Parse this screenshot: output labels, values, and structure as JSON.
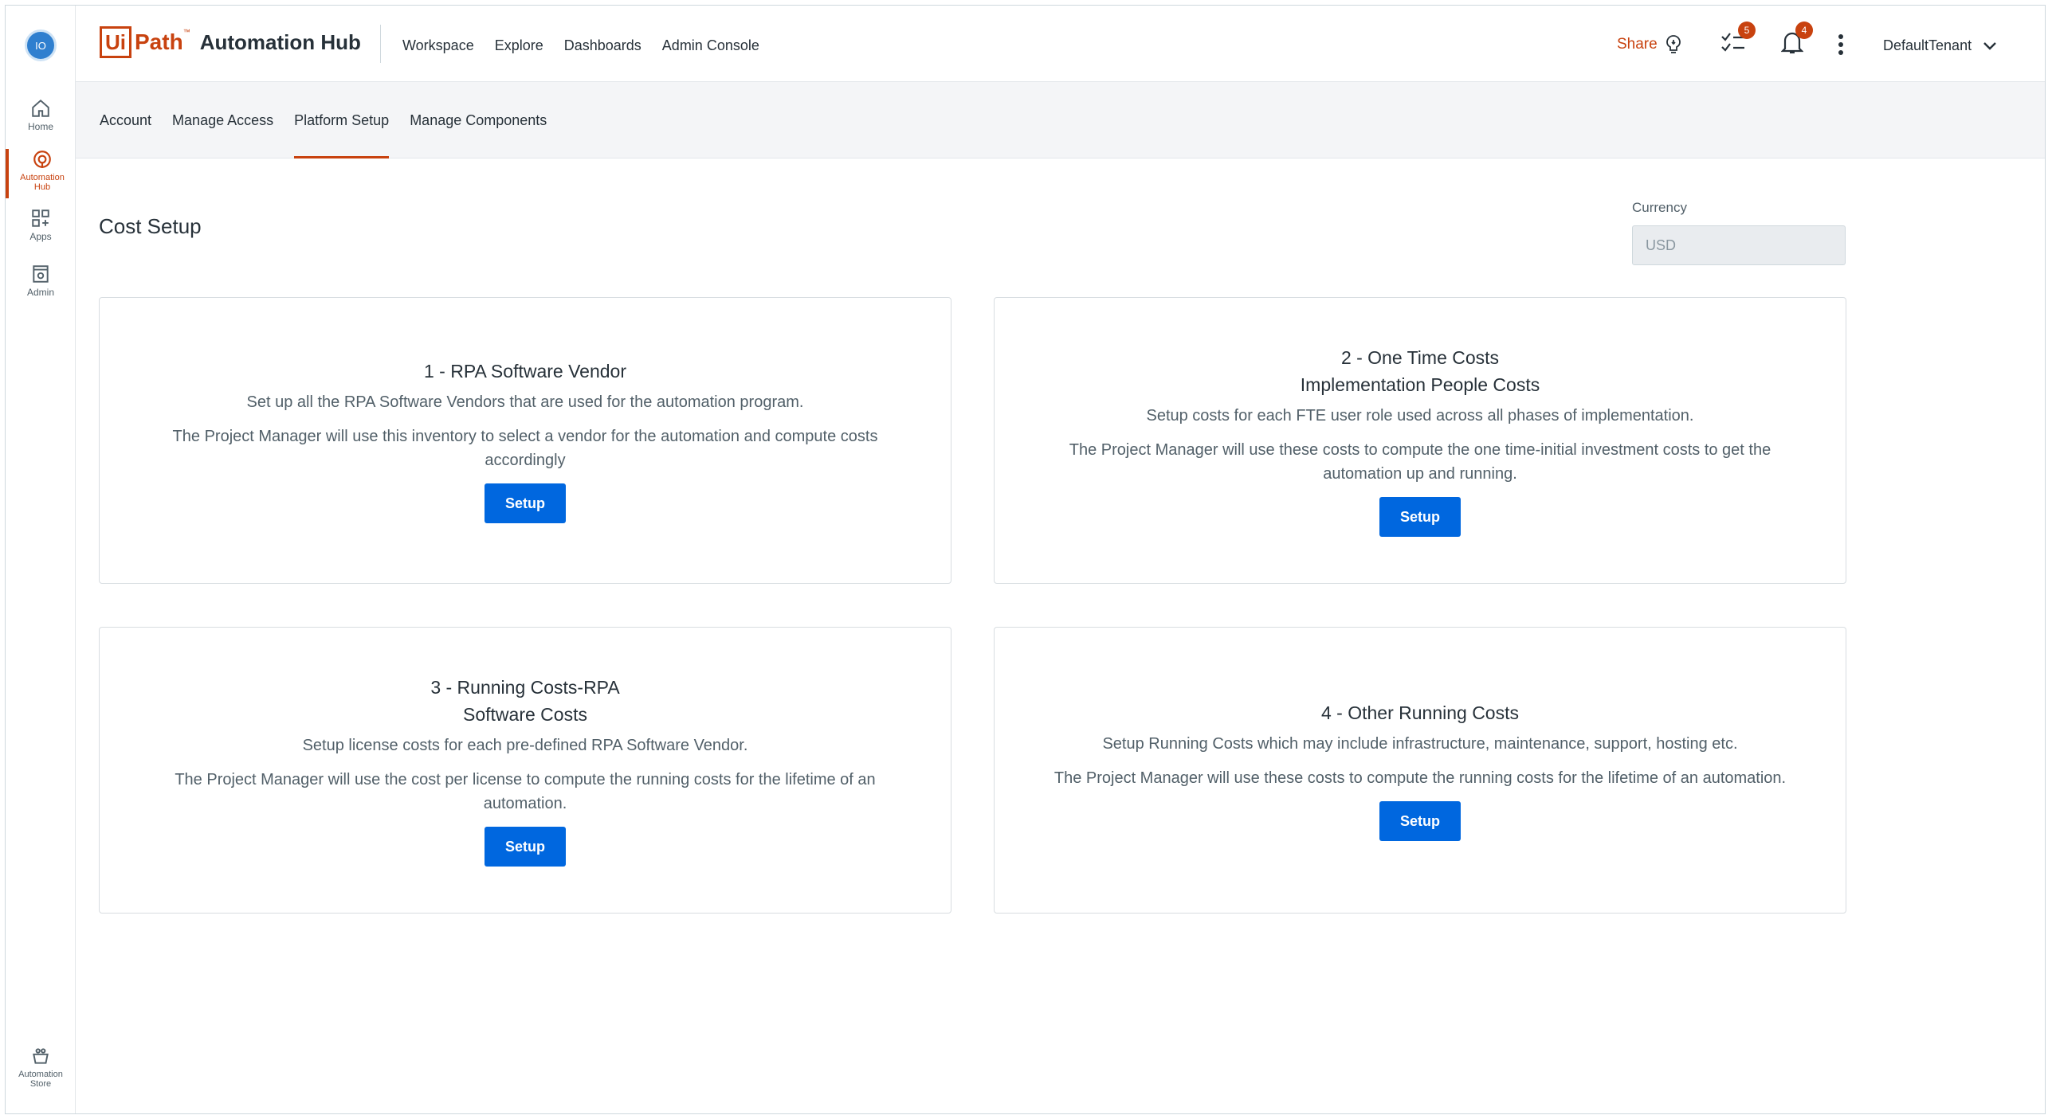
{
  "rail": {
    "avatar": "IO",
    "items": [
      {
        "label": "Home"
      },
      {
        "label": "Automation Hub"
      },
      {
        "label": "Apps"
      },
      {
        "label": "Admin"
      }
    ],
    "bottom": {
      "label": "Automation Store"
    }
  },
  "header": {
    "logo_box": "Ui",
    "logo_path": "Path",
    "logo_tm": "™",
    "product": "Automation Hub",
    "nav": [
      "Workspace",
      "Explore",
      "Dashboards",
      "Admin Console"
    ],
    "share_label": "Share",
    "tasks_badge": "5",
    "notifications_badge": "4",
    "tenant": "DefaultTenant"
  },
  "subnav": {
    "tabs": [
      "Account",
      "Manage Access",
      "Platform Setup",
      "Manage Components"
    ],
    "active": "Platform Setup"
  },
  "main": {
    "title": "Cost Setup",
    "currency_label": "Currency",
    "currency_value": "USD",
    "cards": [
      {
        "title_line1": "1 - RPA Software Vendor",
        "title_line2": "",
        "desc": "Set up all the RPA Software Vendors that are used for the automation program.",
        "note": "The Project Manager will use this inventory to select a vendor for the automation and compute costs accordingly",
        "button": "Setup"
      },
      {
        "title_line1": "2 - One Time Costs",
        "title_line2": "Implementation People Costs",
        "desc": "Setup costs for each FTE user role used across all phases of implementation.",
        "note": "The Project Manager will use these costs to compute the one time-initial investment costs to get the automation up and running.",
        "button": "Setup"
      },
      {
        "title_line1": "3 - Running Costs-RPA",
        "title_line2": "Software Costs",
        "desc": "Setup license costs for each pre-defined RPA Software Vendor.",
        "note": "The Project Manager will use the cost per license to compute the running costs for the lifetime of an automation.",
        "button": "Setup"
      },
      {
        "title_line1": "4 - Other Running Costs",
        "title_line2": "",
        "desc": "Setup Running Costs which may include infrastructure, maintenance, support, hosting etc.",
        "note": "The Project Manager will use these costs to compute the running costs for the lifetime of an automation.",
        "button": "Setup"
      }
    ]
  },
  "colors": {
    "accent": "#c8420f",
    "primary_button": "#0067df"
  }
}
